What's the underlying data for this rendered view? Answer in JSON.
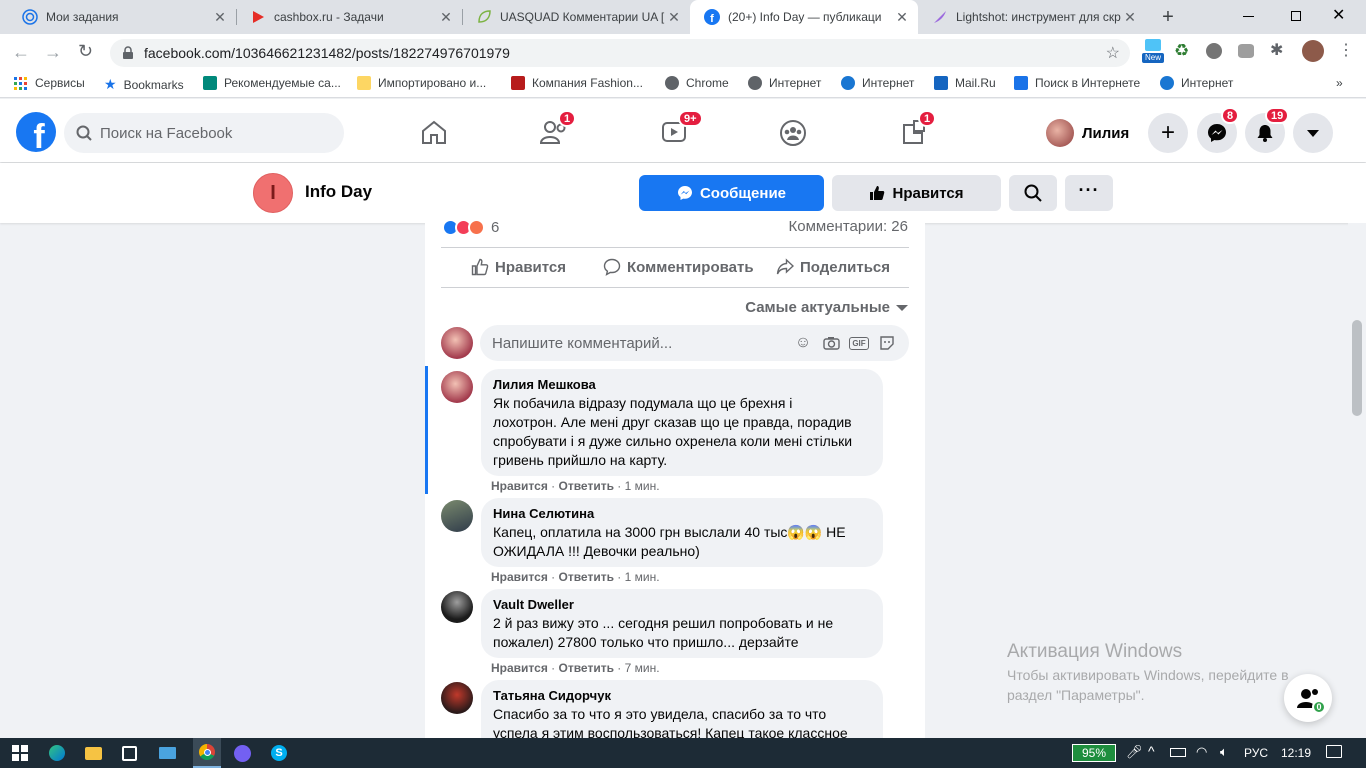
{
  "browser": {
    "tabs": [
      {
        "title": "Мои задания",
        "icon": "target-icon"
      },
      {
        "title": "cashbox.ru - Задачи",
        "icon": "play-icon"
      },
      {
        "title": "UASQUAD Комментарии UA [",
        "icon": "leaf-icon"
      },
      {
        "title": "(20+) Info Day — публикаци",
        "icon": "facebook-icon"
      },
      {
        "title": "Lightshot: инструмент для скр",
        "icon": "feather-icon"
      }
    ],
    "url": "facebook.com/103646621231482/posts/182274976701979",
    "bookmarks": [
      "Сервисы",
      "Bookmarks",
      "Рекомендуемые са...",
      "Импортировано и...",
      "Компания Fashion...",
      "Chrome",
      "Интернет",
      "Интернет",
      "Mail.Ru",
      "Поиск в Интернете",
      "Интернет"
    ],
    "ext_new": "New"
  },
  "fb": {
    "search_placeholder": "Поиск на Facebook",
    "badges": {
      "friends": "1",
      "watch": "9+",
      "gaming": "1",
      "messenger": "8",
      "notifications": "19"
    },
    "user_name": "Лилия"
  },
  "page": {
    "initial": "I",
    "name": "Info Day",
    "message_btn": "Сообщение",
    "like_btn": "Нравится"
  },
  "post": {
    "reactions_count": "6",
    "comments_count": "Комментарии: 26",
    "actions": {
      "like": "Нравится",
      "comment": "Комментировать",
      "share": "Поделиться"
    },
    "sort_label": "Самые актуальные",
    "comment_placeholder": "Напишите комментарий...",
    "comments": [
      {
        "author": "Лилия Мешкова",
        "text": "Як побачила відразу подумала що це брехня і лохотрон. Але мені друг сказав що це правда, порадив спробувати і я дуже сильно охренела коли мені стільки гривень прийшло на карту.",
        "like": "Нравится",
        "reply": "Ответить",
        "time": "1 мин."
      },
      {
        "author": "Нина Селютина",
        "text": "Капец, оплатила на 3000 грн выслали 40 тыс😱😱 НЕ ОЖИДАЛА !!! Девочки реально)",
        "like": "Нравится",
        "reply": "Ответить",
        "time": "1 мин."
      },
      {
        "author": "Vault Dweller",
        "text": "2 й раз вижу это ... сегодня решил попробовать и не пожалел) 27800 только что пришло... дерзайте",
        "like": "Нравится",
        "reply": "Ответить",
        "time": "7 мин."
      },
      {
        "author": "Татьяна Сидорчук",
        "text": "Спасибо за то что я это увидела, спасибо за то что успела я этим воспользоваться! Капец такое классное",
        "like": "",
        "reply": "",
        "time": ""
      }
    ]
  },
  "watermark": {
    "title": "Активация Windows",
    "line1": "Чтобы активировать Windows, перейдите в",
    "line2": "раздел \"Параметры\"."
  },
  "contacts_badge": "0",
  "taskbar": {
    "battery": "95%",
    "lang": "РУС",
    "time": "12:19"
  },
  "colors": {
    "fb_blue": "#1877f2",
    "badge_red": "#e41e3f",
    "page_avatar": "#f07070"
  }
}
